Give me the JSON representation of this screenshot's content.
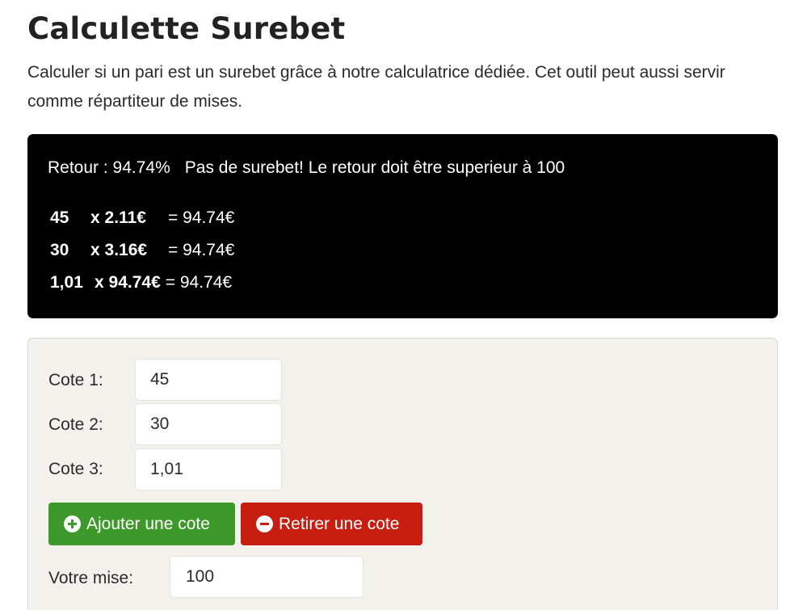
{
  "page": {
    "title": "Calculette Surebet",
    "description": "Calculer si un pari est un surebet grâce à notre calculatrice dédiée. Cet outil peut aussi servir comme répartiteur de mises."
  },
  "result": {
    "return_label": "Retour : 94.74%",
    "status_message": "Pas de surebet! Le retour doit être superieur à 100",
    "rows": [
      {
        "cote": "45",
        "stake": "x 2.11€",
        "payout": "= 94.74€"
      },
      {
        "cote": "30",
        "stake": "x 3.16€",
        "payout": "= 94.74€"
      },
      {
        "cote": "1,01",
        "stake": "x 94.74€",
        "payout": "= 94.74€"
      }
    ]
  },
  "form": {
    "fields": [
      {
        "label": "Cote 1:",
        "value": "45"
      },
      {
        "label": "Cote 2:",
        "value": "30"
      },
      {
        "label": "Cote 3:",
        "value": "1,01"
      }
    ],
    "add_button": {
      "label": "Ajouter une cote",
      "icon": "plus-circle-icon"
    },
    "remove_button": {
      "label": "Retirer une cote",
      "icon": "minus-circle-icon"
    },
    "stake": {
      "label": "Votre mise:",
      "value": "100"
    }
  },
  "colors": {
    "result_background": "#000000",
    "panel_background": "#f3f1ec",
    "add_button": "#3d9a2a",
    "remove_button": "#c81e12"
  }
}
